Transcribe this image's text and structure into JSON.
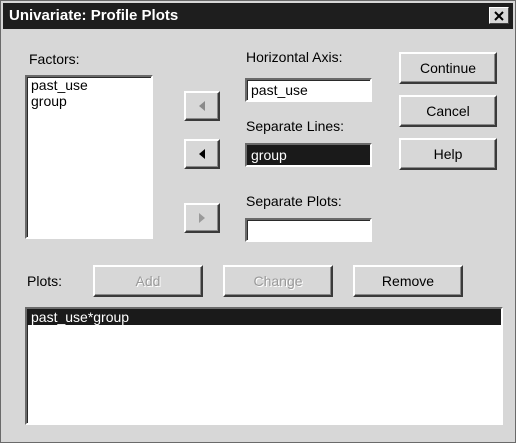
{
  "window": {
    "title": "Univariate: Profile Plots"
  },
  "factors": {
    "label": "Factors:",
    "items": [
      "past_use",
      "group"
    ]
  },
  "horizontal_axis": {
    "label": "Horizontal Axis:",
    "value": "past_use"
  },
  "separate_lines": {
    "label": "Separate Lines:",
    "value": "group"
  },
  "separate_plots": {
    "label": "Separate Plots:",
    "value": ""
  },
  "buttons": {
    "continue": "Continue",
    "cancel": "Cancel",
    "help": "Help",
    "add": "Add",
    "change": "Change",
    "remove": "Remove"
  },
  "plots": {
    "label": "Plots:",
    "items": [
      "past_use*group"
    ]
  },
  "icons": {
    "close": "close-icon",
    "arrow": "left-arrow-icon",
    "arrow_disabled": "right-arrow-icon"
  }
}
